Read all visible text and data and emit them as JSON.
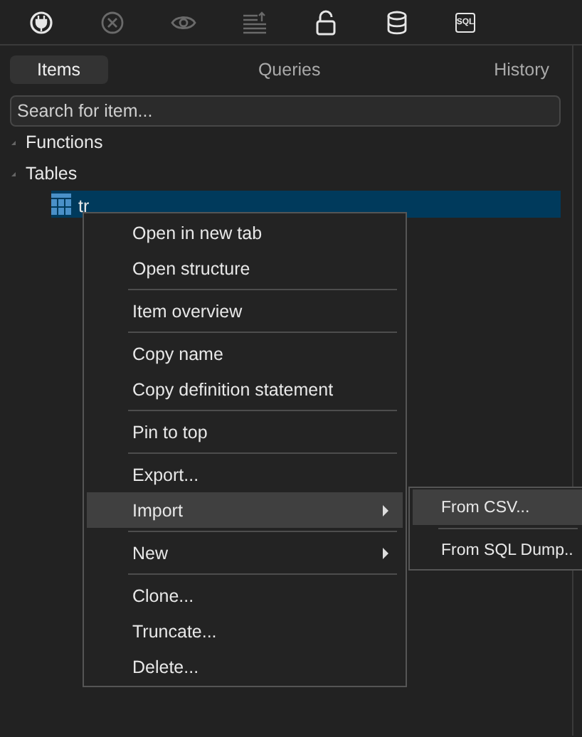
{
  "toolbar": [
    {
      "kind": "plug",
      "disabled": false
    },
    {
      "kind": "close",
      "disabled": true
    },
    {
      "kind": "eye",
      "disabled": true
    },
    {
      "kind": "sort",
      "disabled": true
    },
    {
      "kind": "lock",
      "disabled": false
    },
    {
      "kind": "database",
      "disabled": false
    },
    {
      "kind": "sql",
      "label": "SQL",
      "disabled": false
    }
  ],
  "tabs": [
    {
      "label": "Items",
      "selected": true
    },
    {
      "label": "Queries",
      "selected": false
    },
    {
      "label": "History",
      "selected": false
    }
  ],
  "search": {
    "placeholder": "Search for item..."
  },
  "tree": [
    {
      "label": "Functions",
      "expanded": true
    },
    {
      "label": "Tables",
      "expanded": true,
      "children": [
        {
          "label": "tr",
          "selected": true
        }
      ]
    }
  ],
  "context_menu": [
    {
      "kind": "item",
      "label": "Open in new tab"
    },
    {
      "kind": "item",
      "label": "Open structure"
    },
    {
      "kind": "separator"
    },
    {
      "kind": "item",
      "label": "Item overview"
    },
    {
      "kind": "separator"
    },
    {
      "kind": "item",
      "label": "Copy name"
    },
    {
      "kind": "item",
      "label": "Copy definition statement"
    },
    {
      "kind": "separator"
    },
    {
      "kind": "item",
      "label": "Pin to top"
    },
    {
      "kind": "separator"
    },
    {
      "kind": "item",
      "label": "Export..."
    },
    {
      "kind": "submenu",
      "label": "Import",
      "selected": true,
      "children": [
        {
          "kind": "item",
          "label": "From CSV...",
          "selected": true
        },
        {
          "kind": "separator"
        },
        {
          "kind": "item",
          "label": "From SQL Dump..",
          "selected": false
        }
      ]
    },
    {
      "kind": "separator"
    },
    {
      "kind": "submenu",
      "label": "New",
      "selected": false
    },
    {
      "kind": "separator"
    },
    {
      "kind": "item",
      "label": "Clone..."
    },
    {
      "kind": "item",
      "label": "Truncate..."
    },
    {
      "kind": "item",
      "label": "Delete..."
    }
  ]
}
